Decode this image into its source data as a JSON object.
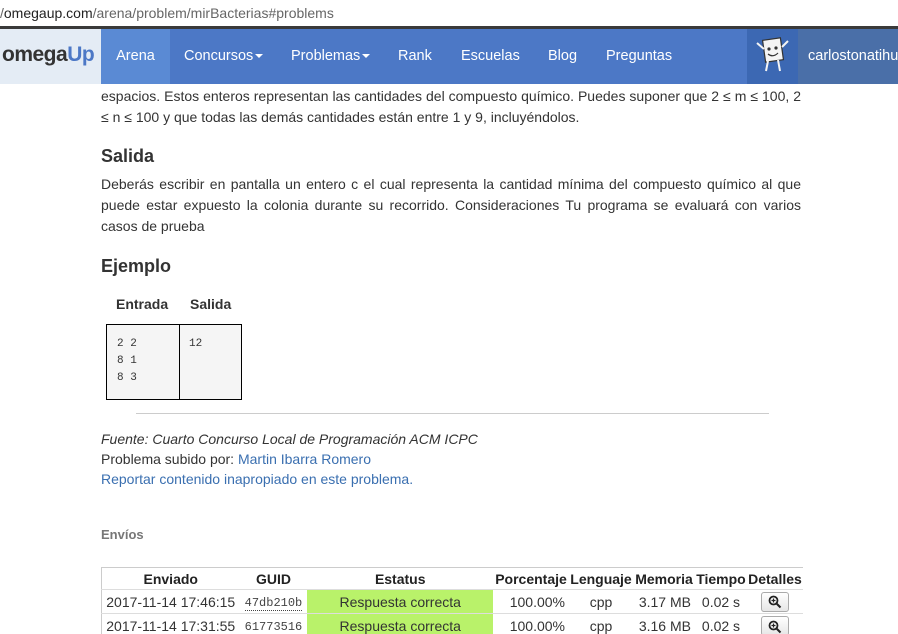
{
  "browser": {
    "url_host": "omegaup.com",
    "url_path": "/arena/problem/mirBacterias#problems"
  },
  "navbar": {
    "brand_omega": "omega",
    "brand_up": "Up",
    "items": [
      {
        "label": "Arena"
      },
      {
        "label": "Concursos"
      },
      {
        "label": "Problemas"
      },
      {
        "label": "Rank"
      },
      {
        "label": "Escuelas"
      },
      {
        "label": "Blog"
      },
      {
        "label": "Preguntas"
      }
    ],
    "username": "carlostonatihu"
  },
  "problem": {
    "intro_text": "espacios. Estos enteros representan las cantidades del compuesto químico. Puedes suponer que 2 ≤ m ≤ 100, 2 ≤ n ≤ 100 y que todas las demás cantidades están entre 1 y 9, incluyéndolos.",
    "output_heading": "Salida",
    "output_text": "Deberás escribir en pantalla un entero c el cual representa la cantidad mínima del compuesto químico al que puede estar expuesto la colonia durante su recorrido. Consideraciones Tu programa se evaluará con varios casos de prueba",
    "example_heading": "Ejemplo",
    "example": {
      "input_header": "Entrada",
      "output_header": "Salida",
      "input": "2 2\n8 1\n8 3",
      "output": "12"
    },
    "source": "Fuente: Cuarto Concurso Local de Programación ACM ICPC",
    "uploaded_by_label": "Problema subido por:",
    "uploaded_by_name": "Martin Ibarra Romero",
    "report_link": "Reportar contenido inapropiado en este problema."
  },
  "runs": {
    "title": "Envíos",
    "columns": [
      "Enviado",
      "GUID",
      "Estatus",
      "Porcentaje",
      "Lenguaje",
      "Memoria",
      "Tiempo",
      "Detalles"
    ],
    "rows": [
      {
        "time": "2017-11-14 17:46:15",
        "guid": "47db210b",
        "status": "Respuesta correcta",
        "percentage": "100.00%",
        "language": "cpp",
        "memory": "3.17 MB",
        "runtime": "0.02 s"
      },
      {
        "time": "2017-11-14 17:31:55",
        "guid": "61773516",
        "status": "Respuesta correcta",
        "percentage": "100.00%",
        "language": "cpp",
        "memory": "3.16 MB",
        "runtime": "0.02 s"
      }
    ],
    "status_color": "#b9f26a",
    "details_icon": "magnifier-icon"
  },
  "colors": {
    "navbar": "#4c78c6",
    "link": "#3a6fb0"
  }
}
